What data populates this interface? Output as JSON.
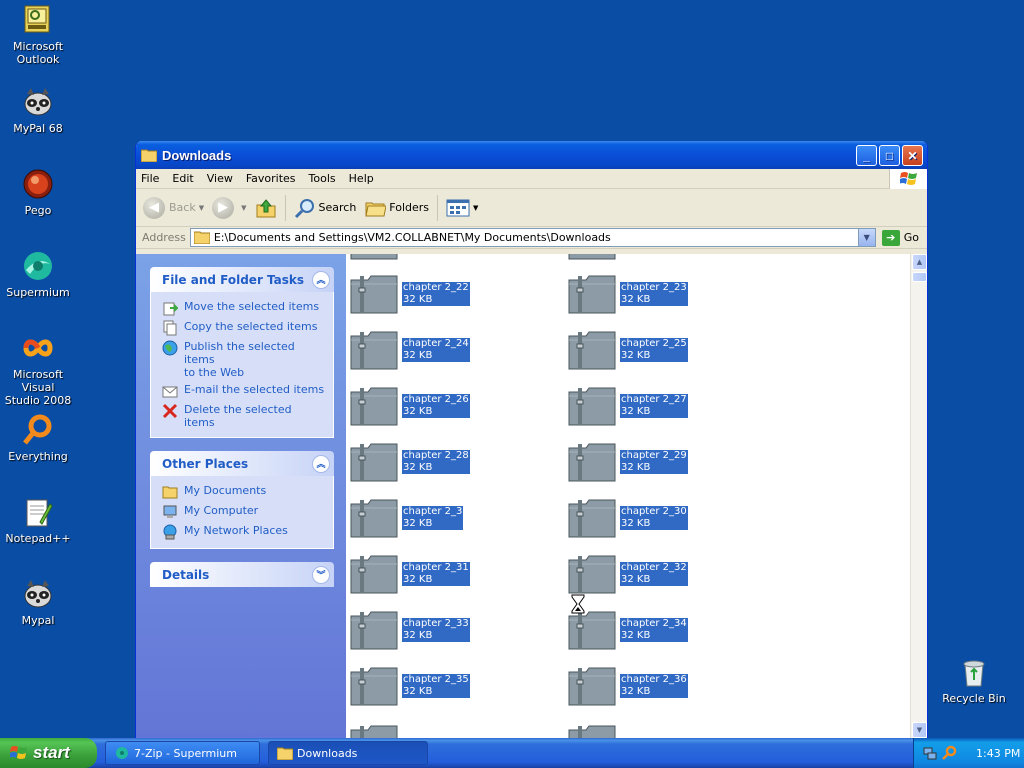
{
  "desktop": {
    "icons": [
      {
        "label": "Microsoft\nOutlook",
        "line1": "Microsoft",
        "line2": "Outlook",
        "icon": "outlook-icon"
      },
      {
        "label": "MyPal 68",
        "line1": "MyPal 68",
        "line2": "",
        "icon": "raccoon-icon"
      },
      {
        "label": "Pego",
        "line1": "Pego",
        "line2": "",
        "icon": "pego-icon"
      },
      {
        "label": "Supermium",
        "line1": "Supermium",
        "line2": "",
        "icon": "supermium-icon"
      },
      {
        "label": "Microsoft Visual Studio 2008",
        "line1": "Microsoft Visual",
        "line2": "Studio 2008",
        "icon": "visual-studio-icon"
      },
      {
        "label": "Everything",
        "line1": "Everything",
        "line2": "",
        "icon": "everything-icon"
      },
      {
        "label": "Notepad++",
        "line1": "Notepad++",
        "line2": "",
        "icon": "notepadpp-icon"
      },
      {
        "label": "Mypal",
        "line1": "Mypal",
        "line2": "",
        "icon": "raccoon-icon"
      }
    ],
    "recycle_bin": "Recycle Bin"
  },
  "window": {
    "title": "Downloads",
    "menu": [
      "File",
      "Edit",
      "View",
      "Favorites",
      "Tools",
      "Help"
    ],
    "toolbar": {
      "back": "Back",
      "search": "Search",
      "folders": "Folders"
    },
    "address": {
      "label": "Address",
      "value": "E:\\Documents and Settings\\VM2.COLLABNET\\My Documents\\Downloads",
      "go": "Go"
    }
  },
  "taskpane": {
    "file_tasks": {
      "title": "File and Folder Tasks",
      "items": [
        "Move the selected items",
        "Copy the selected items",
        "Publish the selected items to the Web",
        "E-mail the selected items",
        "Delete the selected items"
      ],
      "publish_line1": "Publish the selected items",
      "publish_line2": "to the Web"
    },
    "other_places": {
      "title": "Other Places",
      "items": [
        "My Documents",
        "My Computer",
        "My Network Places"
      ]
    },
    "details": {
      "title": "Details"
    }
  },
  "files": [
    {
      "name": "chapter 2_22",
      "size": "32 KB"
    },
    {
      "name": "chapter 2_23",
      "size": "32 KB"
    },
    {
      "name": "chapter 2_24",
      "size": "32 KB"
    },
    {
      "name": "chapter 2_25",
      "size": "32 KB"
    },
    {
      "name": "chapter 2_26",
      "size": "32 KB"
    },
    {
      "name": "chapter 2_27",
      "size": "32 KB"
    },
    {
      "name": "chapter 2_28",
      "size": "32 KB"
    },
    {
      "name": "chapter 2_29",
      "size": "32 KB"
    },
    {
      "name": "chapter 2_3",
      "size": "32 KB"
    },
    {
      "name": "chapter 2_30",
      "size": "32 KB"
    },
    {
      "name": "chapter 2_31",
      "size": "32 KB"
    },
    {
      "name": "chapter 2_32",
      "size": "32 KB"
    },
    {
      "name": "chapter 2_33",
      "size": "32 KB"
    },
    {
      "name": "chapter 2_34",
      "size": "32 KB"
    },
    {
      "name": "chapter 2_35",
      "size": "32 KB"
    },
    {
      "name": "chapter 2_36",
      "size": "32 KB"
    }
  ],
  "taskbar": {
    "start": "start",
    "tasks": [
      "7-Zip - Supermium",
      "Downloads"
    ],
    "clock": "1:43 PM"
  }
}
